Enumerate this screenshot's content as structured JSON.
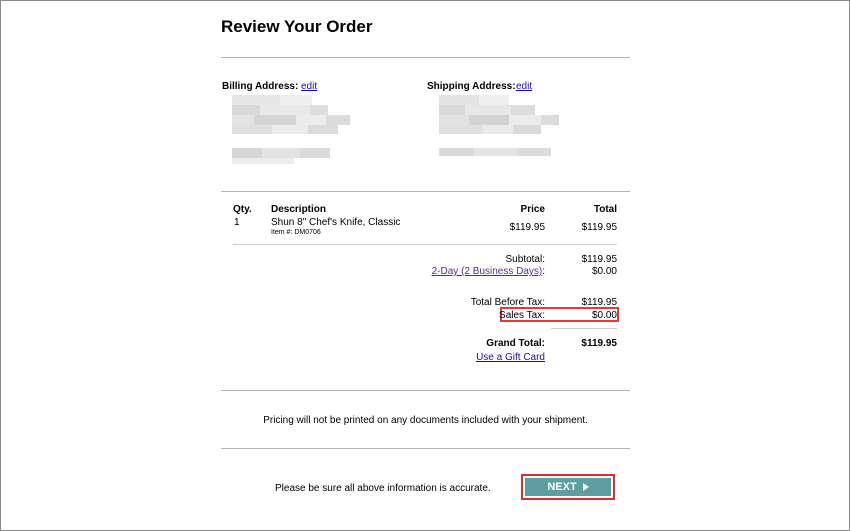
{
  "page": {
    "title": "Review Your Order"
  },
  "addresses": {
    "billing_label": "Billing Address:",
    "shipping_label": "Shipping Address:",
    "edit_label": "edit"
  },
  "table": {
    "headers": {
      "qty": "Qty.",
      "description": "Description",
      "price": "Price",
      "total": "Total"
    },
    "items": [
      {
        "qty": "1",
        "name": "Shun 8\" Chef's Knife, Classic",
        "item_no": "Item #: DM0706",
        "price": "$119.95",
        "total": "$119.95"
      }
    ]
  },
  "summary": {
    "subtotal_label": "Subtotal:",
    "subtotal": "$119.95",
    "shipping_label": "2-Day (2 Business Days)",
    "shipping_colon": ":",
    "shipping": "$0.00",
    "before_tax_label": "Total Before Tax:",
    "before_tax": "$119.95",
    "tax_label": "Sales Tax:",
    "tax": "$0.00",
    "grand_label": "Grand Total:",
    "grand": "$119.95",
    "gift_card": "Use a Gift Card"
  },
  "notes": {
    "pricing": "Pricing will not be printed on any documents included with your shipment.",
    "accuracy": "Please be sure all above information is accurate."
  },
  "actions": {
    "next_label": "NEXT"
  }
}
